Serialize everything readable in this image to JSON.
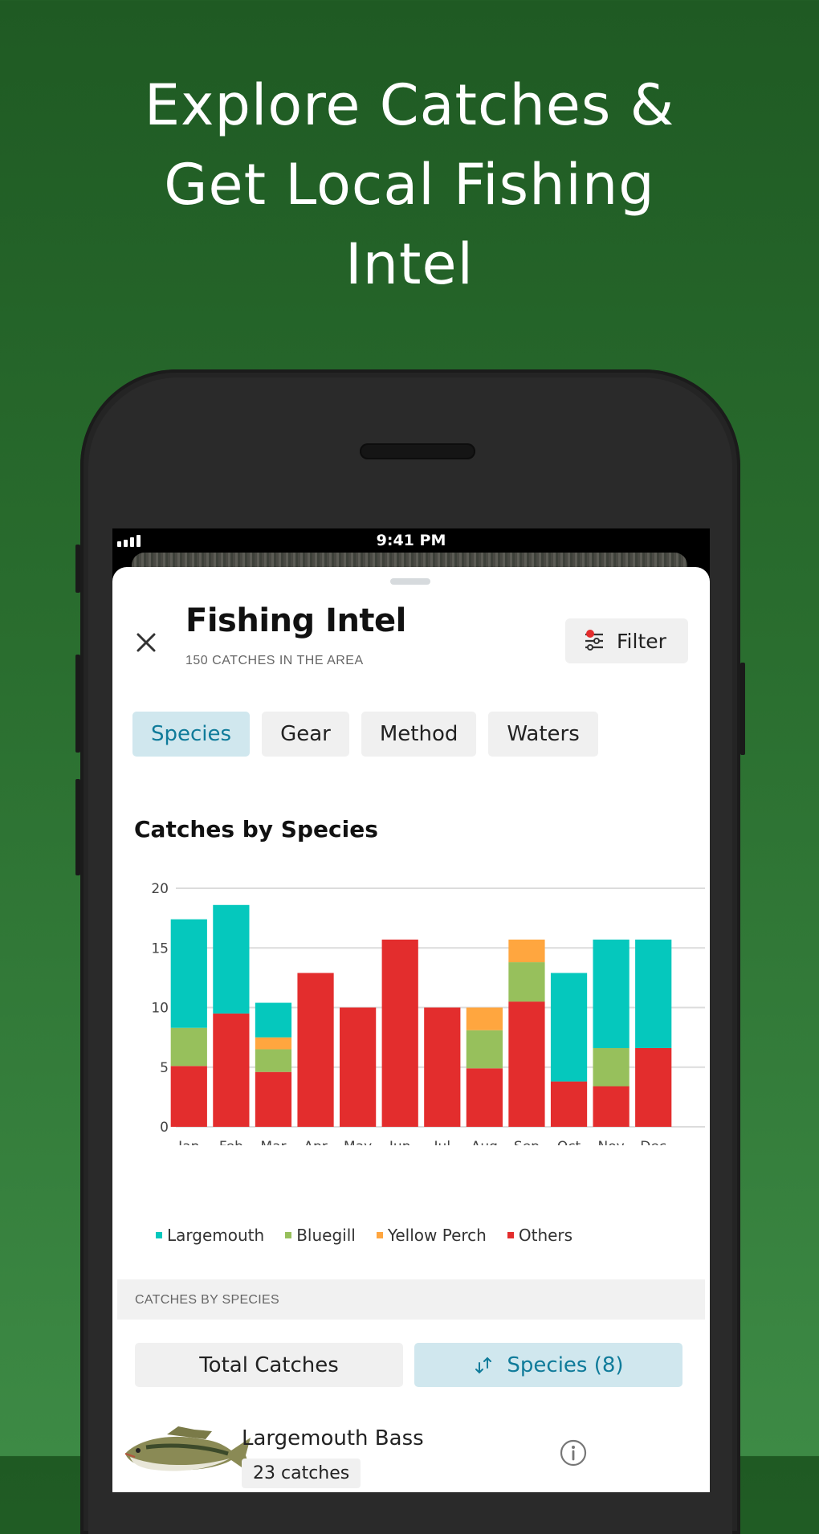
{
  "headline": {
    "lines": [
      "Explore Catches &",
      "Get Local Fishing",
      "Intel"
    ]
  },
  "status_bar": {
    "time": "9:41 PM",
    "signal_icon": "cellular-signal-icon"
  },
  "header": {
    "title": "Fishing Intel",
    "subtitle": "150 CATCHES IN THE AREA",
    "close_icon": "close-icon",
    "filter_label": "Filter",
    "filter_icon": "sliders-icon",
    "filter_active_color": "#e32d2d"
  },
  "tabs": [
    {
      "label": "Species",
      "active": true
    },
    {
      "label": "Gear",
      "active": false
    },
    {
      "label": "Method",
      "active": false
    },
    {
      "label": "Waters",
      "active": false
    }
  ],
  "chart_section": {
    "title": "Catches by Species"
  },
  "chart_data": {
    "type": "bar",
    "stacked": true,
    "title": "Catches by Species",
    "xlabel": "",
    "ylabel": "",
    "ylim": [
      0,
      20
    ],
    "yticks": [
      0,
      5,
      10,
      15,
      20
    ],
    "grid": true,
    "legend_position": "bottom",
    "categories": [
      "Jan",
      "Feb",
      "Mar",
      "Apr",
      "May",
      "Jun",
      "Jul",
      "Aug",
      "Sep",
      "Oct",
      "Nov",
      "Dec"
    ],
    "series": [
      {
        "name": "Others",
        "color": "#e32d2d",
        "values": [
          5.1,
          9.5,
          4.6,
          12.9,
          10.0,
          15.7,
          10.0,
          4.9,
          10.5,
          3.8,
          3.4,
          6.6
        ]
      },
      {
        "name": "Bluegill",
        "color": "#97c05c",
        "values": [
          3.2,
          0,
          1.9,
          0,
          0,
          0,
          0,
          3.2,
          3.3,
          0,
          3.2,
          0
        ]
      },
      {
        "name": "Yellow Perch",
        "color": "#ffa63f",
        "values": [
          0,
          0,
          1.0,
          0,
          0,
          0,
          0,
          1.9,
          1.9,
          0,
          0,
          0
        ]
      },
      {
        "name": "Largemouth",
        "color": "#05c8bd",
        "values": [
          9.1,
          9.1,
          2.9,
          0,
          0,
          0,
          0,
          0,
          0,
          9.1,
          9.1,
          9.1
        ]
      }
    ],
    "legend": [
      "Largemouth",
      "Bluegill",
      "Yellow Perch",
      "Others"
    ]
  },
  "legend": [
    {
      "label": "Largemouth",
      "color": "#05c8bd"
    },
    {
      "label": "Bluegill",
      "color": "#97c05c"
    },
    {
      "label": "Yellow Perch",
      "color": "#ffa63f"
    },
    {
      "label": "Others",
      "color": "#e32d2d"
    }
  ],
  "list_section": {
    "header": "CATCHES BY SPECIES",
    "toggle_total": "Total Catches",
    "toggle_species": "Species (8)",
    "sort_icon": "sort-arrows-icon",
    "items": [
      {
        "name": "Largemouth Bass",
        "catches": "23 catches",
        "image": "largemouth-bass-image",
        "info_icon": "info-icon"
      }
    ]
  },
  "colors": {
    "accent": "#0f7b9a",
    "accent_bg": "#d0e7ee",
    "chip_bg": "#f0f0f0"
  }
}
